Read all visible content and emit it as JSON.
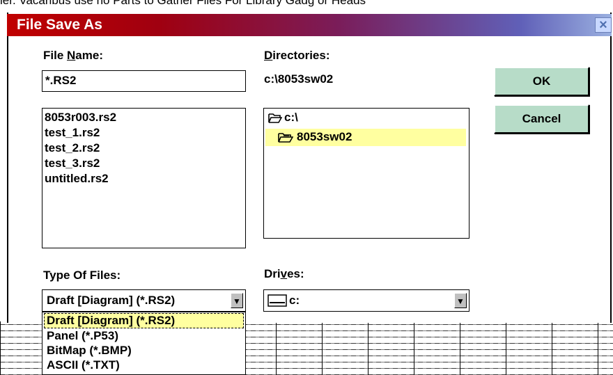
{
  "background": {
    "top_text": "ler. Vacaribus use no Parts to Gather Files For Library Gadg or Heads"
  },
  "dialog": {
    "title": "File Save As",
    "close_glyph": "×",
    "file_name": {
      "label_pre": "File ",
      "label_u": "N",
      "label_post": "ame:",
      "value": "*.RS2"
    },
    "files": [
      "8053r003.rs2",
      "test_1.rs2",
      "test_2.rs2",
      "test_3.rs2",
      "untitled.rs2"
    ],
    "directories": {
      "label_u": "D",
      "label_post": "irectories:",
      "current": "c:\\8053sw02",
      "items": [
        {
          "label": "c:\\",
          "icon": "folder-open-icon"
        },
        {
          "label": "8053sw02",
          "icon": "folder-open-icon",
          "selected": true
        }
      ]
    },
    "type_of_files": {
      "label": "Type Of Files:",
      "selected": "Draft [Diagram]  (*.RS2)",
      "options": [
        "Draft [Diagram]  (*.RS2)",
        "Panel (*.P53)",
        "BitMap (*.BMP)",
        "ASCII (*.TXT)"
      ]
    },
    "drives": {
      "label_pre": "Dri",
      "label_u": "v",
      "label_post": "es:",
      "selected": "c:"
    },
    "buttons": {
      "ok": "OK",
      "cancel": "Cancel"
    },
    "colors": {
      "button_bg": "#b7dcc8",
      "selection_bg": "#ffffa0",
      "title_start": "#c00000",
      "title_end": "#9ab0e0"
    }
  }
}
